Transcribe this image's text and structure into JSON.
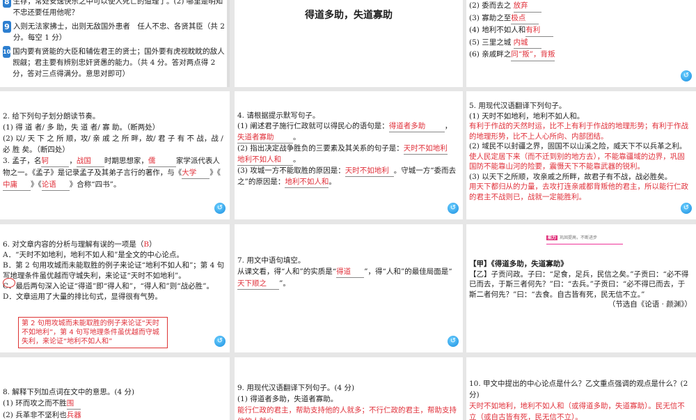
{
  "slide1": {
    "items": [
      {
        "badge": "8",
        "text": "生存，常处安逸快乐之中可以使人死亡的道理了。(2) 哪里是明知不忠还要任用他呢？"
      },
      {
        "badge": "9",
        "text": "入则无法家拂士，出则无敌国外患者　任人不忠、各贤其臣（共 2 分。每空 1 分）"
      },
      {
        "badge": "10",
        "text": "国内要有贤能的大臣和辅佐君王的贤士；国外要有虎视眈眈的敌人觊觎；君主要有辨别忠奸贤愚的能力。（共 4 分。答对两点得 2 分，答对三点得满分。意思对即可）"
      }
    ]
  },
  "slide2": {
    "title": "得道多助，失道寡助"
  },
  "slide3": {
    "items": [
      {
        "q": "(2) 委而去之",
        "a": "放弃"
      },
      {
        "q": "(3) 寡助之至",
        "a": "极点"
      },
      {
        "q": "(4) 地利不如人和",
        "a": "有利"
      },
      {
        "q": "(5) 三里之城",
        "a": "内城"
      },
      {
        "q": "(6) 亲戚畔之",
        "a": "同“叛”，背叛"
      }
    ]
  },
  "slide4": {
    "q2": "2. 给下列句子划分朗读节奏。",
    "s1": "(1) 得 道 者/ 多 助，失 道 者/ 寡 助。（断两处）",
    "s2": "(2) 以/ 天 下 之 所 顺，攻/ 亲 戚 之 所 畔，故/ 君 子 有 不 战，战 / 必 胜 矣。（断四处）",
    "q3a": "3. 孟子，名",
    "a1": "轲",
    "q3b": "，",
    "a2": "战国",
    "q3c": "时期思想家，",
    "a3": "儒",
    "q3d": "家学派代表人物之一。《孟子》是记录孟子及其弟子言行的著作，与《",
    "a4": "大学",
    "q3e": "》《",
    "a5": "中庸",
    "q3f": "》《",
    "a6": "论语",
    "q3g": "》合称“四书”。"
  },
  "slide5": {
    "q": "4. 请根据提示默写句子。",
    "p1": "(1) 阐述君子施行仁政就可以得民心的语句是：",
    "a1": "得道者多助",
    "a2": "失道者寡助",
    "p2": "(2) 指出决定战争胜负的三要素及其关系的句子是：",
    "a3": "天时不如地利",
    "a4": "地利不如人和",
    "p3": "(3) 攻城一方不能取胜的原因是：",
    "a5": "天时不如地利",
    "p4": "。守城一方“委而去之”的原因是：",
    "a6": "地利不如人和",
    "end": "。",
    "comma": "，",
    "dot": "。"
  },
  "slide6": {
    "q": "5. 用现代汉语翻译下列句子。",
    "s1": "(1) 天时不如地利，地利不如人和。",
    "a1": "有利于作战的天然时运，比不上有利于作战的地理形势；有利于作战的地理形势，比不上人心所向、内部团结。",
    "s2": "(2) 域民不以封疆之界，固国不以山溪之险，威天下不以兵革之利。",
    "a2": "使人民定居下来（而不迁到别的地方去），不能靠疆域的边界，巩固国防不能靠山河的险要，震慑天下不能靠武器的锐利。",
    "s3": "(3) 以天下之所顺，攻亲戚之所畔，故君子有不战，战必胜矣。",
    "a3": "用天下都归从的力量，去攻打连亲戚都背叛他的君主，所以能行仁政的君主不战则已，战就一定能胜利。"
  },
  "slide7": {
    "q": "6. 对文章内容的分析与理解有误的一项是（",
    "ans": "B",
    "qend": "）",
    "A": "A．“天时不如地利，地利不如人和”是全文的中心论点。",
    "B": "B．第 2 句用攻城而未能取胜的例子来论证“地利不如人和”；第 4 句写地理条件虽优越而守城失利，来论证“天时不如地利”。",
    "C": "C．最后两句深入论证“得道”即“得人和”，“得人和”则“战必胜”。",
    "D": "D．文章运用了大量的排比句式，显得很有气势。",
    "note": "第 2 句用攻城而未能取胜的例子来论证“天时不如地利”，第 4 句写地理条件虽优越而守城失利，来论证“地利不如人和”"
  },
  "slide8": {
    "q": "7. 用文中语句填空。",
    "p1": "从课文看，得“人和”的实质是“",
    "a1": "得道",
    "p2": "”，得“人和”的最佳局面是“",
    "a2": "天下顺之",
    "p3": "”。"
  },
  "slide9": {
    "section": "能力",
    "header_note": "巩固提高，不断进步",
    "jia": "【甲】《得道多助，失道寡助》",
    "yi": "【乙】子贡问政。子曰：“足食，足兵，民信之矣。”子贡曰：“必不得已而去，于斯三者何先？”曰：“去兵。”子贡曰：“必不得已而去，于斯二者何先？”曰：“去食。自古皆有死，民无信不立。”",
    "src": "（节选自《论语 · 颜渊》）"
  },
  "slide10": {
    "q": "8. 解释下列加点词在文中的意思。(4 分)",
    "s1": "(1) 环而攻之而不胜",
    "a1": "围",
    "s2": "(2) 兵革非不坚利也",
    "a2": "兵器"
  },
  "slide11": {
    "q": "9. 用现代汉语翻译下列句子。(4 分)",
    "s1": "(1) 得道者多助，失道者寡助。",
    "a1": "能行仁政的君主，帮助支持他的人就多；不行仁政的君主，帮助支持他的人就少。"
  },
  "slide12": {
    "q": "10. 甲文中提出的中心论点是什么？乙文重点强调的观点是什么？(2 分)",
    "a1": "天时不如地利，地利不如人和（或得道多助，失道寡助）。民无信不立（或自古皆有死，民无信不立）。"
  },
  "back_icon": "back-arrow-icon"
}
